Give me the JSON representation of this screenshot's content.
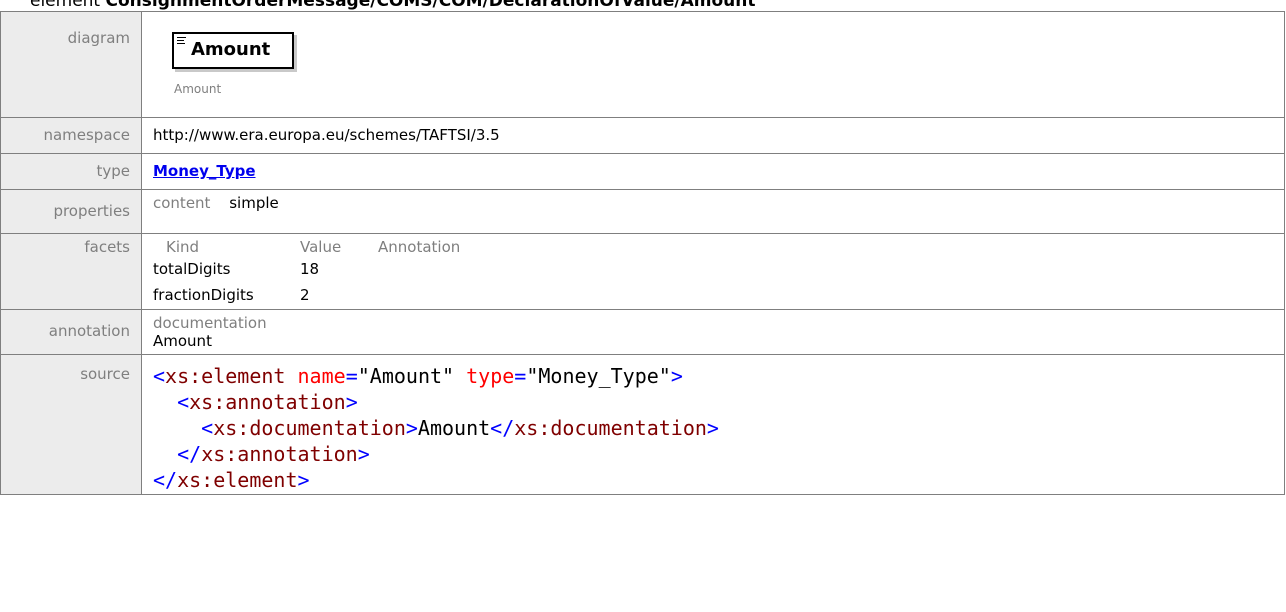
{
  "page": {
    "title_prefix": "element",
    "title_path": "ConsignmentOrderMessage/COMS/COM/DeclarationOfValue/Amount"
  },
  "rows": {
    "diagram": {
      "label": "diagram",
      "element_name": "Amount",
      "caption": "Amount"
    },
    "namespace": {
      "label": "namespace",
      "value": "http://www.era.europa.eu/schemes/TAFTSI/3.5"
    },
    "type": {
      "label": "type",
      "value": "Money_Type"
    },
    "properties": {
      "label": "properties",
      "key": "content",
      "value": "simple"
    },
    "facets": {
      "label": "facets",
      "headers": [
        "Kind",
        "Value",
        "Annotation"
      ],
      "items": [
        {
          "kind": "totalDigits",
          "value": "18"
        },
        {
          "kind": "fractionDigits",
          "value": "2"
        }
      ]
    },
    "annotation": {
      "label": "annotation",
      "key": "documentation",
      "value": "Amount"
    },
    "source": {
      "label": "source",
      "el": "xs:element",
      "attr_name": "name",
      "attr_name_val": "\"Amount\"",
      "attr_type": "type",
      "attr_type_val": "\"Money_Type\"",
      "annotation_tag": "xs:annotation",
      "doc_tag": "xs:documentation",
      "doc_text": "Amount"
    }
  }
}
